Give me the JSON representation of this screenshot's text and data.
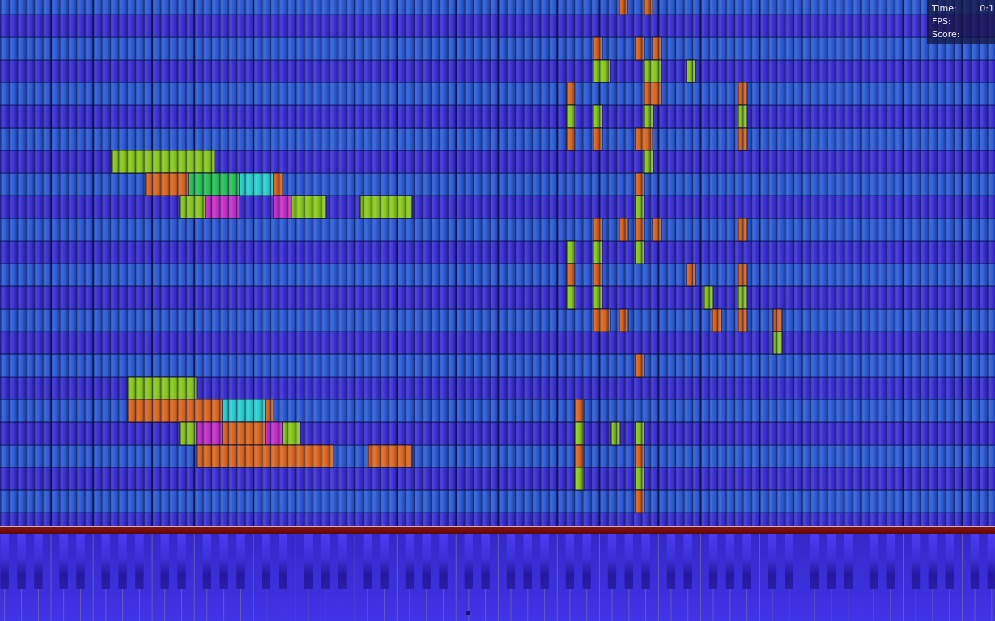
{
  "stats_overlay": {
    "rows": [
      {
        "label": "Time:",
        "value": "0:1"
      },
      {
        "label": "FPS:"
      },
      {
        "label": "Score:"
      }
    ]
  }
}
